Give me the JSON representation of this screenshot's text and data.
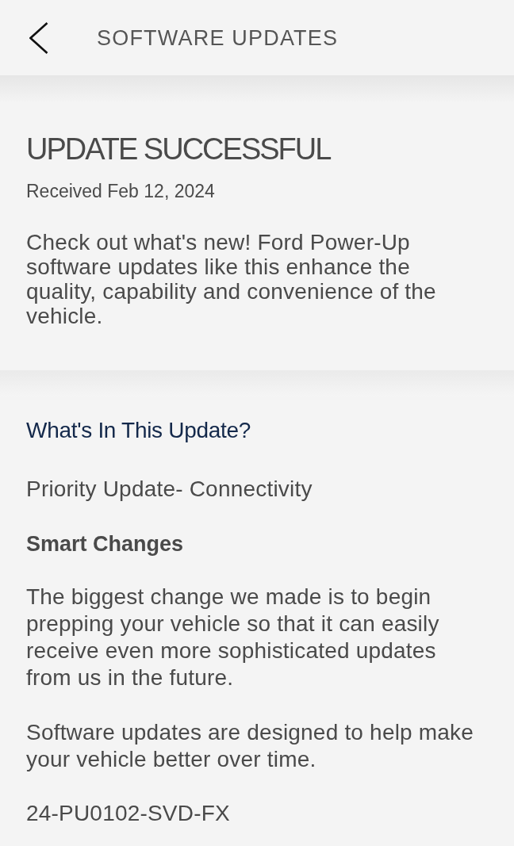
{
  "header": {
    "title": "SOFTWARE UPDATES"
  },
  "status": {
    "title": "UPDATE SUCCESSFUL",
    "received": "Received Feb 12, 2024",
    "description": "Check out what's new! Ford Power-Up software updates like this enhance the quality, capability and convenience of the vehicle."
  },
  "details": {
    "heading": "What's In This Update?",
    "update_name": "Priority Update- Connectivity",
    "subheading": "Smart Changes",
    "paragraphs": [
      "The biggest change we made is to begin prepping your vehicle so that it can easily receive even more sophisticated updates from us in the future.",
      "Software updates are designed to help make your vehicle better over time."
    ],
    "code": "24-PU0102-SVD-FX"
  }
}
